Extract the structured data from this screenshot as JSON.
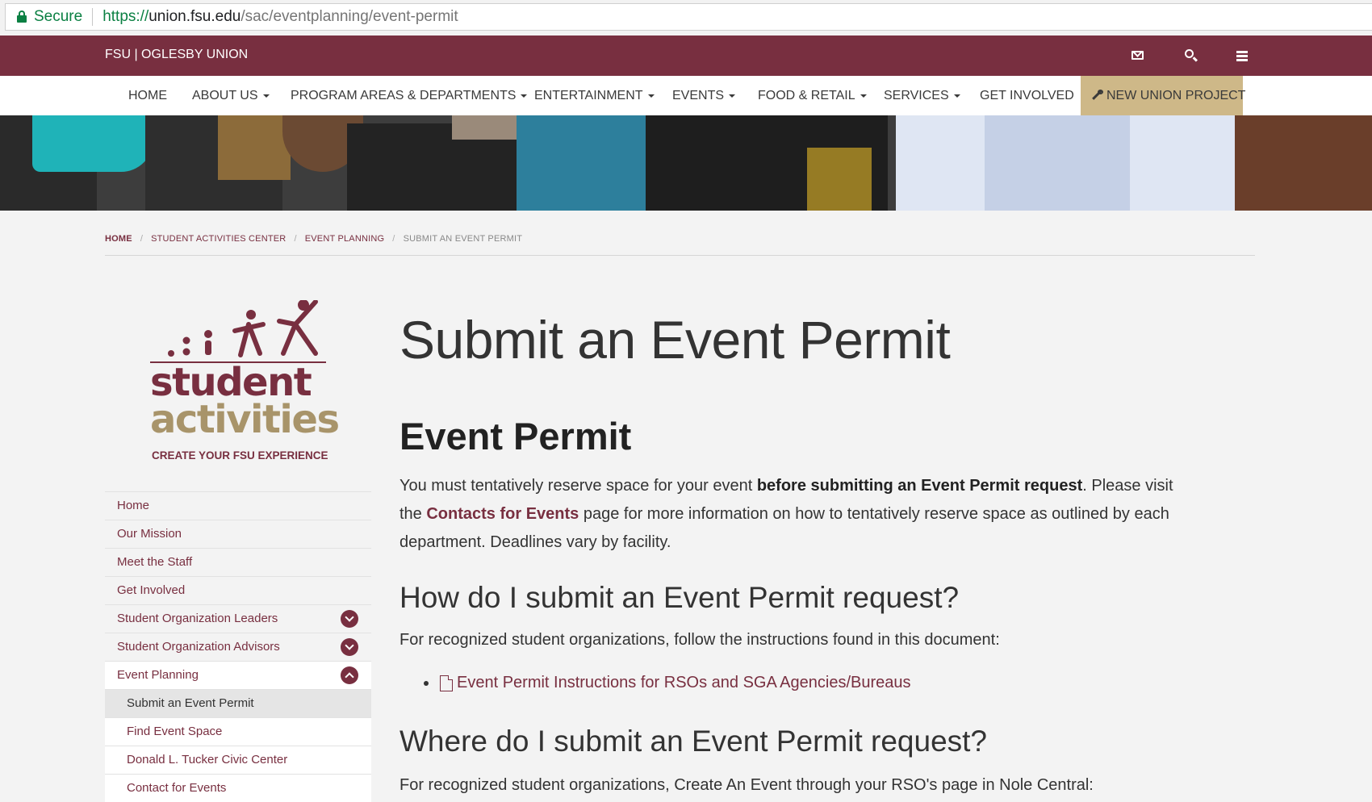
{
  "browser": {
    "secure_label": "Secure",
    "url_proto": "https://",
    "url_host": "union.fsu.edu",
    "url_path": "/sac/eventplanning/event-permit"
  },
  "topbar": {
    "brand": "FSU | OGLESBY UNION"
  },
  "nav": {
    "items": [
      {
        "label": "HOME"
      },
      {
        "label": "ABOUT US"
      },
      {
        "label": "PROGRAM AREAS & DEPARTMENTS"
      },
      {
        "label": "ENTERTAINMENT"
      },
      {
        "label": "EVENTS"
      },
      {
        "label": "FOOD & RETAIL"
      },
      {
        "label": "SERVICES"
      },
      {
        "label": "GET INVOLVED"
      },
      {
        "label": "NEW UNION PROJECT"
      }
    ]
  },
  "breadcrumb": {
    "items": [
      "HOME",
      "STUDENT ACTIVITIES CENTER",
      "EVENT PLANNING",
      "SUBMIT AN EVENT PERMIT"
    ]
  },
  "logo": {
    "line1": "student",
    "line2": "activities",
    "tagline": "CREATE YOUR FSU EXPERIENCE"
  },
  "sidebar": {
    "items": [
      {
        "label": "Home"
      },
      {
        "label": "Our Mission"
      },
      {
        "label": "Meet the Staff"
      },
      {
        "label": "Get Involved"
      },
      {
        "label": "Student Organization Leaders"
      },
      {
        "label": "Student Organization Advisors"
      },
      {
        "label": "Event Planning"
      },
      {
        "label": "Submit an Event Permit"
      },
      {
        "label": "Find Event Space"
      },
      {
        "label": "Donald L. Tucker Civic Center"
      },
      {
        "label": "Contact for Events"
      }
    ]
  },
  "main": {
    "title": "Submit an Event Permit",
    "heading": "Event Permit",
    "intro_1": "You must tentatively reserve space for your event ",
    "intro_bold": "before submitting an Event Permit request",
    "intro_2": ". Please visit the ",
    "intro_link": "Contacts for Events",
    "intro_3": " page for more information on how to tentatively reserve space as outlined by each department. Deadlines vary by facility.",
    "how_heading": "How do I submit an Event Permit request?",
    "how_text": "For recognized student organizations, follow the instructions found in this document:",
    "doc_link": "Event Permit Instructions for RSOs and SGA Agencies/Bureaus",
    "where_heading": "Where do I submit an Event Permit request?",
    "where_text": "For recognized student organizations, Create An Event through your RSO's page in Nole Central:"
  },
  "colors": {
    "garnet": "#782f40",
    "gold": "#ceb888",
    "background": "#f3f3f3"
  }
}
